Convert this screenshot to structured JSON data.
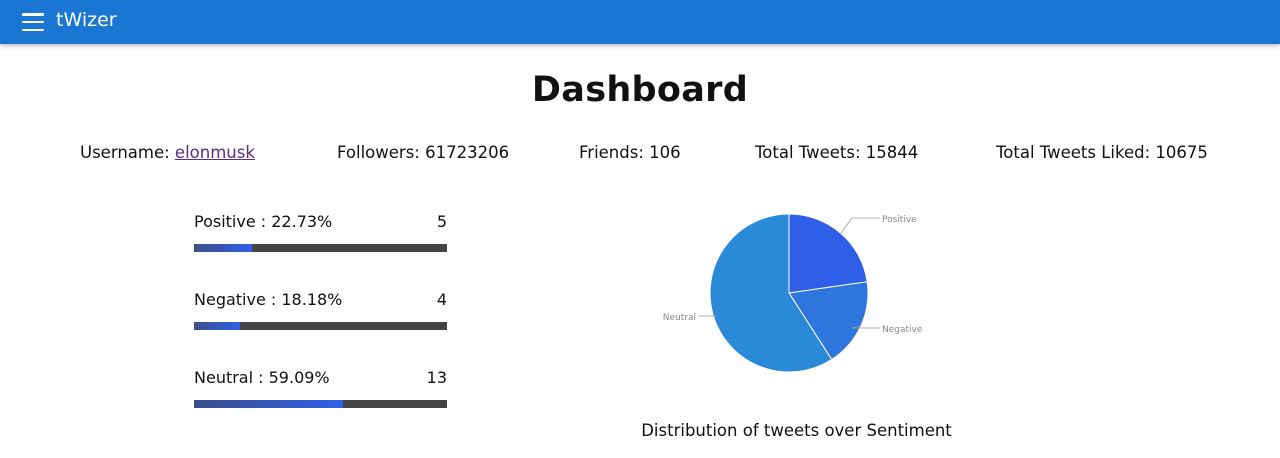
{
  "app": {
    "title": "tWizer",
    "menu_icon": "menu-icon"
  },
  "page": {
    "title": "Dashboard"
  },
  "stats": {
    "username_label": "Username:",
    "username": "elonmusk",
    "followers": "Followers: 61723206",
    "friends": "Friends: 106",
    "total_tweets": "Total Tweets: 15844",
    "total_liked": "Total Tweets Liked: 10675"
  },
  "sentiments": [
    {
      "label": "Positive : 22.73%",
      "count": "5",
      "fraction": 0.2273
    },
    {
      "label": "Negative : 18.18%",
      "count": "4",
      "fraction": 0.1818
    },
    {
      "label": "Neutral : 59.09%",
      "count": "13",
      "fraction": 0.5909
    }
  ],
  "chart_data": {
    "type": "pie",
    "title": "",
    "caption": "Distribution of tweets over Sentiment",
    "slices": [
      {
        "name": "Positive",
        "value": 5,
        "color": "#2f5fe8"
      },
      {
        "name": "Negative",
        "value": 4,
        "color": "#2e76de"
      },
      {
        "name": "Neutral",
        "value": 13,
        "color": "#2b8ad8"
      }
    ],
    "label_color": "#888888"
  },
  "colors": {
    "topbar": "#1976d2",
    "bar_track": "#444444",
    "link": "#5b2a86"
  }
}
